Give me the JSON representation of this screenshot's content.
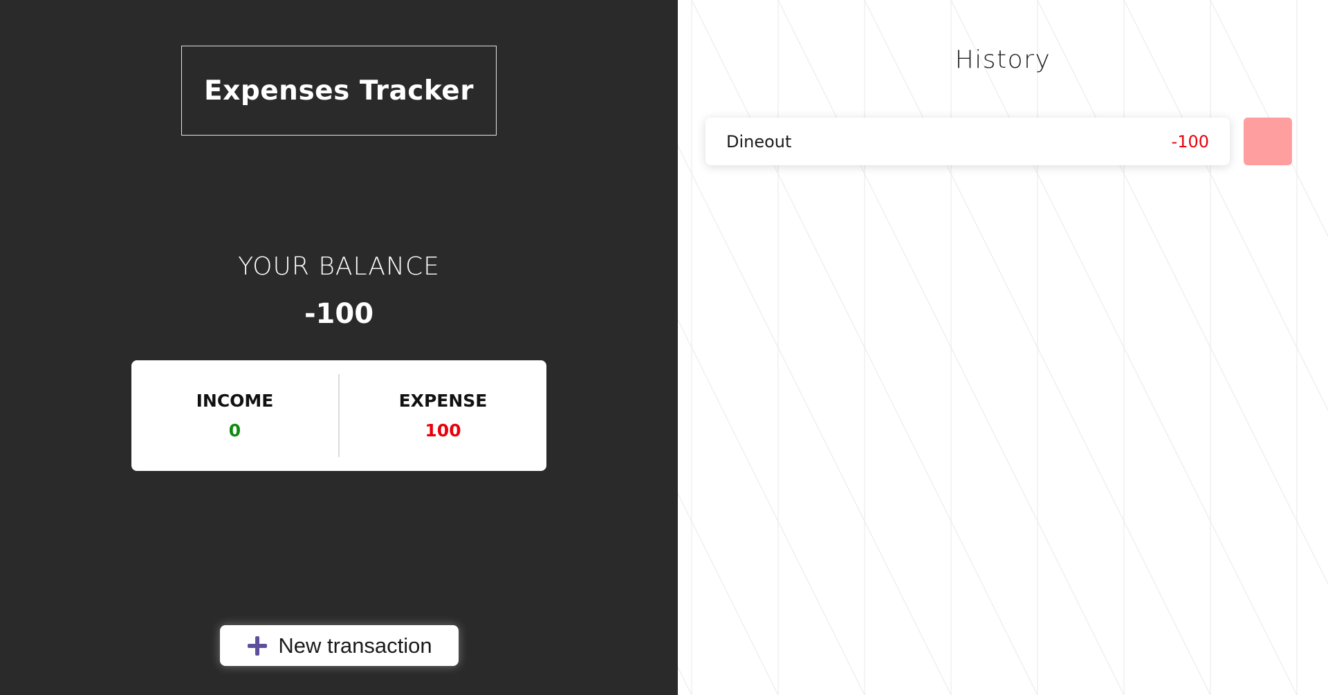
{
  "app": {
    "title": "Expenses Tracker"
  },
  "balance": {
    "label": "YOUR BALANCE",
    "value": "-100"
  },
  "summary": {
    "income_label": "INCOME",
    "income_value": "0",
    "expense_label": "EXPENSE",
    "expense_value": "100"
  },
  "new_transaction": {
    "label": "New transaction",
    "icon": "plus-icon"
  },
  "history": {
    "title": "History",
    "transactions": [
      {
        "name": "Dineout",
        "amount": "-100"
      }
    ]
  },
  "colors": {
    "left_bg": "#2a2a2a",
    "income": "#0f8a0f",
    "expense": "#e8000b",
    "delete_button": "#ff9e9e",
    "accent": "#5f4f9a"
  }
}
